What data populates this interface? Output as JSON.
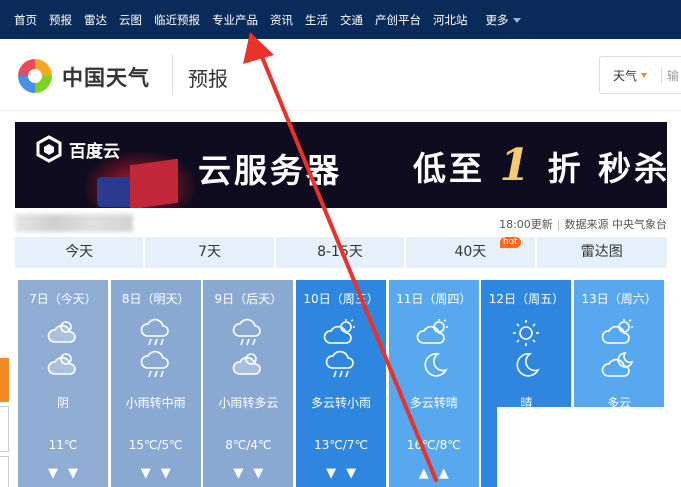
{
  "topnav": {
    "items": [
      "首页",
      "预报",
      "雷达",
      "云图",
      "临近预报",
      "专业产品",
      "资讯",
      "生活",
      "交通",
      "产创平台",
      "河北站"
    ],
    "more": "更多"
  },
  "header": {
    "brand": "中国天气",
    "subtitle": "预报",
    "search_select": "天气",
    "search_placeholder": "输"
  },
  "banner": {
    "advertiser": "百度云",
    "headline": "云服务器",
    "promo_prefix": "低至",
    "promo_number": "1",
    "promo_suffix": "折 秒杀"
  },
  "info": {
    "update_time": "18:00更新",
    "source": "数据来源 中央气象台"
  },
  "tabs": [
    {
      "label": "今天"
    },
    {
      "label": "7天"
    },
    {
      "label": "8-15天"
    },
    {
      "label": "40天",
      "badge": "hot"
    },
    {
      "label": "雷达图"
    }
  ],
  "forecast": [
    {
      "date": "7日（今天）",
      "desc": "阴",
      "temp": "11℃",
      "wind": "down-down",
      "icon1": "cloud-sun-icon",
      "icon2": "cloud-sun-icon",
      "color": "#8facd2"
    },
    {
      "date": "8日（明天）",
      "desc": "小雨转中雨",
      "temp": "15℃/5℃",
      "wind": "down-down",
      "icon1": "rain-cloud-icon",
      "icon2": "rain-cloud-icon",
      "color": "#8aa9d2"
    },
    {
      "date": "9日（后天）",
      "desc": "小雨转多云",
      "temp": "8℃/4℃",
      "wind": "down-down",
      "icon1": "rain-cloud-icon",
      "icon2": "cloud-sun-icon",
      "color": "#8aa9d2"
    },
    {
      "date": "10日（周三）",
      "desc": "多云转小雨",
      "temp": "13℃/7℃",
      "wind": "down-down",
      "icon1": "sun-cloud-icon",
      "icon2": "rain-cloud-icon",
      "color": "#2e86df"
    },
    {
      "date": "11日（周四）",
      "desc": "多云转晴",
      "temp": "16℃/8℃",
      "wind": "up-up",
      "icon1": "sun-cloud-icon",
      "icon2": "moon-icon",
      "color": "#58a8ef"
    },
    {
      "date": "12日（周五）",
      "desc": "晴",
      "temp": "",
      "wind": "",
      "icon1": "sun-icon",
      "icon2": "moon-icon",
      "color": "#2e86df"
    },
    {
      "date": "13日（周六）",
      "desc": "多云",
      "temp": "",
      "wind": "",
      "icon1": "sun-cloud-icon",
      "icon2": "cloud-moon-icon",
      "color": "#58a8ef"
    }
  ]
}
